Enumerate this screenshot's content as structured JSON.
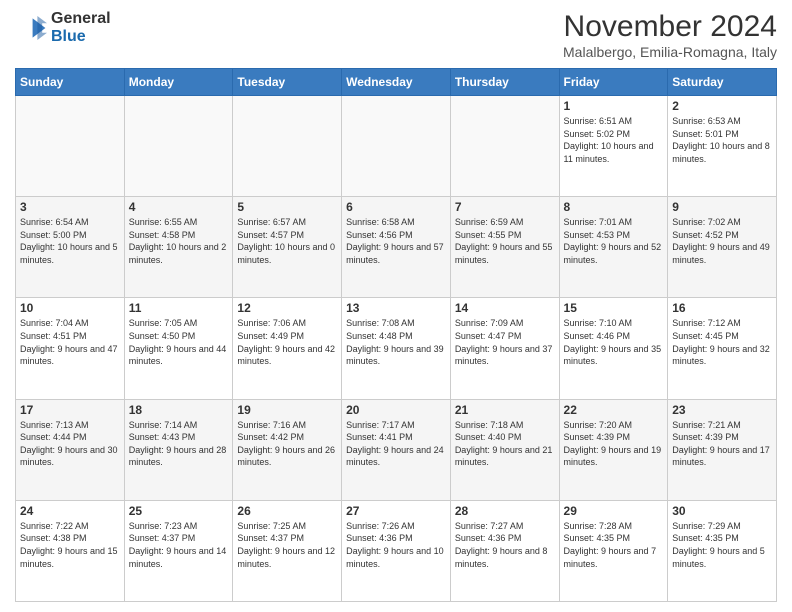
{
  "header": {
    "logo_general": "General",
    "logo_blue": "Blue",
    "month_title": "November 2024",
    "subtitle": "Malalbergo, Emilia-Romagna, Italy"
  },
  "weekdays": [
    "Sunday",
    "Monday",
    "Tuesday",
    "Wednesday",
    "Thursday",
    "Friday",
    "Saturday"
  ],
  "weeks": [
    [
      {
        "day": "",
        "info": ""
      },
      {
        "day": "",
        "info": ""
      },
      {
        "day": "",
        "info": ""
      },
      {
        "day": "",
        "info": ""
      },
      {
        "day": "",
        "info": ""
      },
      {
        "day": "1",
        "info": "Sunrise: 6:51 AM\nSunset: 5:02 PM\nDaylight: 10 hours and 11 minutes."
      },
      {
        "day": "2",
        "info": "Sunrise: 6:53 AM\nSunset: 5:01 PM\nDaylight: 10 hours and 8 minutes."
      }
    ],
    [
      {
        "day": "3",
        "info": "Sunrise: 6:54 AM\nSunset: 5:00 PM\nDaylight: 10 hours and 5 minutes."
      },
      {
        "day": "4",
        "info": "Sunrise: 6:55 AM\nSunset: 4:58 PM\nDaylight: 10 hours and 2 minutes."
      },
      {
        "day": "5",
        "info": "Sunrise: 6:57 AM\nSunset: 4:57 PM\nDaylight: 10 hours and 0 minutes."
      },
      {
        "day": "6",
        "info": "Sunrise: 6:58 AM\nSunset: 4:56 PM\nDaylight: 9 hours and 57 minutes."
      },
      {
        "day": "7",
        "info": "Sunrise: 6:59 AM\nSunset: 4:55 PM\nDaylight: 9 hours and 55 minutes."
      },
      {
        "day": "8",
        "info": "Sunrise: 7:01 AM\nSunset: 4:53 PM\nDaylight: 9 hours and 52 minutes."
      },
      {
        "day": "9",
        "info": "Sunrise: 7:02 AM\nSunset: 4:52 PM\nDaylight: 9 hours and 49 minutes."
      }
    ],
    [
      {
        "day": "10",
        "info": "Sunrise: 7:04 AM\nSunset: 4:51 PM\nDaylight: 9 hours and 47 minutes."
      },
      {
        "day": "11",
        "info": "Sunrise: 7:05 AM\nSunset: 4:50 PM\nDaylight: 9 hours and 44 minutes."
      },
      {
        "day": "12",
        "info": "Sunrise: 7:06 AM\nSunset: 4:49 PM\nDaylight: 9 hours and 42 minutes."
      },
      {
        "day": "13",
        "info": "Sunrise: 7:08 AM\nSunset: 4:48 PM\nDaylight: 9 hours and 39 minutes."
      },
      {
        "day": "14",
        "info": "Sunrise: 7:09 AM\nSunset: 4:47 PM\nDaylight: 9 hours and 37 minutes."
      },
      {
        "day": "15",
        "info": "Sunrise: 7:10 AM\nSunset: 4:46 PM\nDaylight: 9 hours and 35 minutes."
      },
      {
        "day": "16",
        "info": "Sunrise: 7:12 AM\nSunset: 4:45 PM\nDaylight: 9 hours and 32 minutes."
      }
    ],
    [
      {
        "day": "17",
        "info": "Sunrise: 7:13 AM\nSunset: 4:44 PM\nDaylight: 9 hours and 30 minutes."
      },
      {
        "day": "18",
        "info": "Sunrise: 7:14 AM\nSunset: 4:43 PM\nDaylight: 9 hours and 28 minutes."
      },
      {
        "day": "19",
        "info": "Sunrise: 7:16 AM\nSunset: 4:42 PM\nDaylight: 9 hours and 26 minutes."
      },
      {
        "day": "20",
        "info": "Sunrise: 7:17 AM\nSunset: 4:41 PM\nDaylight: 9 hours and 24 minutes."
      },
      {
        "day": "21",
        "info": "Sunrise: 7:18 AM\nSunset: 4:40 PM\nDaylight: 9 hours and 21 minutes."
      },
      {
        "day": "22",
        "info": "Sunrise: 7:20 AM\nSunset: 4:39 PM\nDaylight: 9 hours and 19 minutes."
      },
      {
        "day": "23",
        "info": "Sunrise: 7:21 AM\nSunset: 4:39 PM\nDaylight: 9 hours and 17 minutes."
      }
    ],
    [
      {
        "day": "24",
        "info": "Sunrise: 7:22 AM\nSunset: 4:38 PM\nDaylight: 9 hours and 15 minutes."
      },
      {
        "day": "25",
        "info": "Sunrise: 7:23 AM\nSunset: 4:37 PM\nDaylight: 9 hours and 14 minutes."
      },
      {
        "day": "26",
        "info": "Sunrise: 7:25 AM\nSunset: 4:37 PM\nDaylight: 9 hours and 12 minutes."
      },
      {
        "day": "27",
        "info": "Sunrise: 7:26 AM\nSunset: 4:36 PM\nDaylight: 9 hours and 10 minutes."
      },
      {
        "day": "28",
        "info": "Sunrise: 7:27 AM\nSunset: 4:36 PM\nDaylight: 9 hours and 8 minutes."
      },
      {
        "day": "29",
        "info": "Sunrise: 7:28 AM\nSunset: 4:35 PM\nDaylight: 9 hours and 7 minutes."
      },
      {
        "day": "30",
        "info": "Sunrise: 7:29 AM\nSunset: 4:35 PM\nDaylight: 9 hours and 5 minutes."
      }
    ]
  ]
}
